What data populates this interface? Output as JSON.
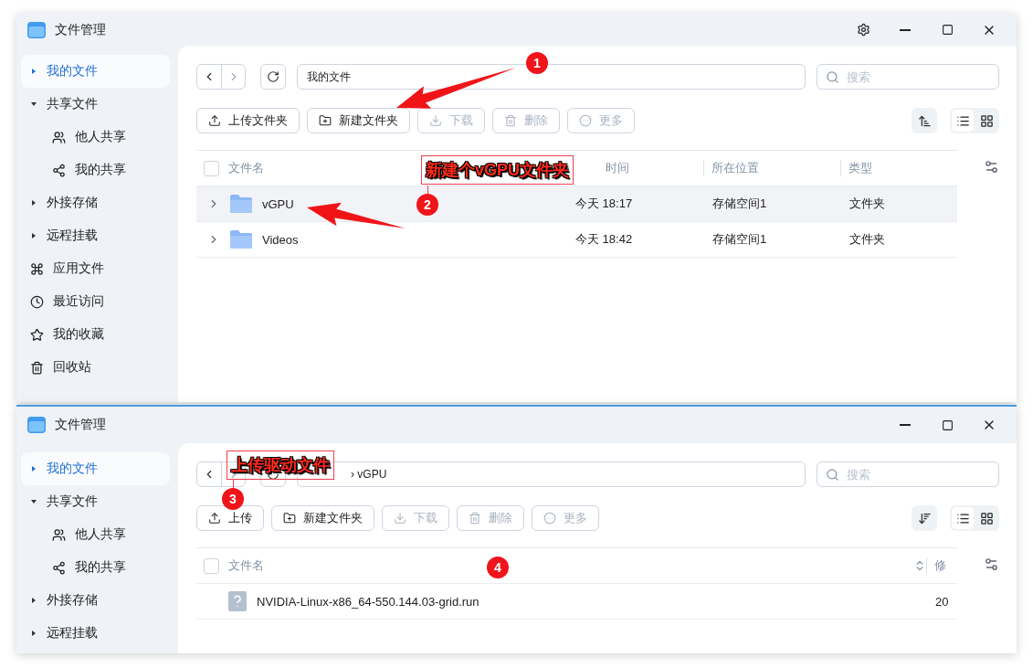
{
  "windows": [
    {
      "title": "文件管理",
      "settings_button": true,
      "sidebar": [
        {
          "label": "我的文件",
          "kind": "tree",
          "selected": true,
          "expanded": false
        },
        {
          "label": "共享文件",
          "kind": "tree",
          "selected": false,
          "expanded": true,
          "children": [
            {
              "label": "他人共享",
              "kind": "people",
              "selected": false
            },
            {
              "label": "我的共享",
              "kind": "share",
              "selected": false
            }
          ]
        },
        {
          "label": "外接存储",
          "kind": "tree",
          "selected": false,
          "expanded": false
        },
        {
          "label": "远程挂载",
          "kind": "tree",
          "selected": false,
          "expanded": false
        },
        {
          "label": "应用文件",
          "kind": "apps",
          "selected": false
        },
        {
          "label": "最近访问",
          "kind": "clock",
          "selected": false
        },
        {
          "label": "我的收藏",
          "kind": "star",
          "selected": false
        },
        {
          "label": "回收站",
          "kind": "trash",
          "selected": false
        }
      ],
      "path": "我的文件",
      "search": {
        "placeholder": "搜索"
      },
      "toolbar": [
        {
          "label": "上传文件夹",
          "kind": "upload",
          "disabled": false
        },
        {
          "label": "新建文件夹",
          "kind": "new-folder",
          "disabled": false
        },
        {
          "label": "下载",
          "kind": "download",
          "disabled": true
        },
        {
          "label": "删除",
          "kind": "delete",
          "disabled": true
        },
        {
          "label": "更多",
          "kind": "more",
          "disabled": true
        }
      ],
      "sort_descending": false,
      "views": [
        {
          "kind": "list",
          "selected": true
        },
        {
          "kind": "grid",
          "selected": false
        }
      ],
      "table": {
        "all_selected": false,
        "columns": [
          {
            "label": "文件名",
            "sortable": false
          },
          {
            "label": "时间",
            "sortable": false
          },
          {
            "label": "所在位置",
            "sortable": false
          },
          {
            "label": "类型",
            "sortable": false
          }
        ],
        "rows": [
          {
            "kind": "folder",
            "selected": true,
            "cells": [
              "vGPU",
              "今天 18:17",
              "存储空间1",
              "文件夹"
            ]
          },
          {
            "kind": "folder",
            "selected": false,
            "cells": [
              "Videos",
              "今天 18:42",
              "存储空间1",
              "文件夹"
            ]
          }
        ]
      }
    },
    {
      "title": "文件管理",
      "settings_button": false,
      "sidebar": [
        {
          "label": "我的文件",
          "kind": "tree",
          "selected": true,
          "expanded": false
        },
        {
          "label": "共享文件",
          "kind": "tree",
          "selected": false,
          "expanded": true,
          "children": [
            {
              "label": "他人共享",
              "kind": "people",
              "selected": false
            },
            {
              "label": "我的共享",
              "kind": "share",
              "selected": false
            }
          ]
        },
        {
          "label": "外接存储",
          "kind": "tree",
          "selected": false,
          "expanded": false
        },
        {
          "label": "远程挂载",
          "kind": "tree",
          "selected": false,
          "expanded": false
        }
      ],
      "path": "› vGPU",
      "search": {
        "placeholder": "搜索"
      },
      "toolbar": [
        {
          "label": "上传",
          "kind": "upload",
          "disabled": false
        },
        {
          "label": "新建文件夹",
          "kind": "new-folder",
          "disabled": false
        },
        {
          "label": "下载",
          "kind": "download",
          "disabled": true
        },
        {
          "label": "删除",
          "kind": "delete",
          "disabled": true
        },
        {
          "label": "更多",
          "kind": "more",
          "disabled": true
        }
      ],
      "sort_descending": true,
      "views": [
        {
          "kind": "list",
          "selected": true
        },
        {
          "kind": "grid",
          "selected": false
        }
      ],
      "table": {
        "all_selected": false,
        "columns": [
          {
            "label": "文件名",
            "sortable": true
          },
          {
            "label": "修",
            "sortable": false
          }
        ],
        "rows": [
          {
            "kind": "file",
            "selected": false,
            "cells": [
              "NVIDIA-Linux-x86_64-550.144.03-grid.run",
              "20"
            ]
          }
        ]
      }
    }
  ],
  "annotations": [
    {
      "kind": "arrow"
    },
    {
      "kind": "badge",
      "text": "1"
    },
    {
      "kind": "label",
      "text": "新建个vGPU文件夹"
    },
    {
      "kind": "badge",
      "text": "2"
    },
    {
      "kind": "arrow"
    },
    {
      "kind": "label",
      "text": "上传驱动文件"
    },
    {
      "kind": "badge",
      "text": "3"
    },
    {
      "kind": "badge",
      "text": "4"
    }
  ]
}
